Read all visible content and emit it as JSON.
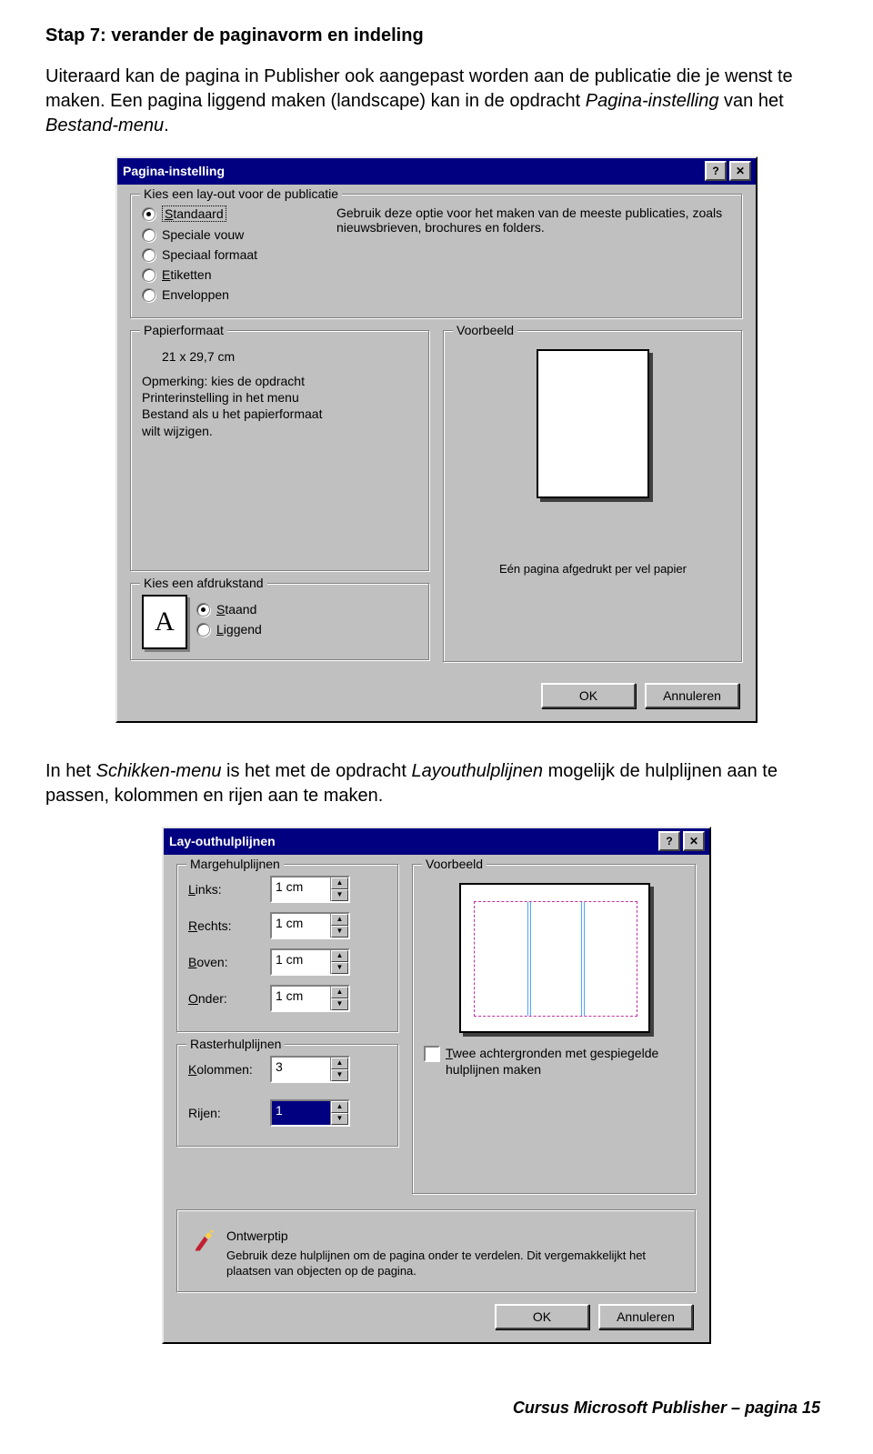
{
  "step_title": "Stap 7: verander de paginavorm en indeling",
  "intro": {
    "p1a": "Uiteraard kan de pagina in Publisher ook aangepast worden aan de publicatie die je wenst te maken. Een pagina liggend maken (landscape) kan in de opdracht ",
    "p1b": "Pagina-instelling",
    "p1c": " van het ",
    "p1d": "Bestand-menu",
    "p1e": "."
  },
  "dialog1": {
    "title": "Pagina-instelling",
    "layout_legend": "Kies een lay-out voor de publicatie",
    "options": {
      "standaard": "Standaard",
      "speciale_vouw": "Speciale vouw",
      "speciaal_formaat": "Speciaal formaat",
      "etiketten": "Etiketten",
      "enveloppen": "Enveloppen"
    },
    "desc": "Gebruik deze optie voor het maken van de meeste publicaties, zoals nieuwsbrieven, brochures en folders.",
    "papier_legend": "Papierformaat",
    "papier_size": "21 x 29,7 cm",
    "papier_note": "Opmerking: kies de opdracht Printerinstelling in het menu Bestand als u het papierformaat wilt wijzigen.",
    "voorbeeld_legend": "Voorbeeld",
    "voorbeeld_caption": "Eén pagina afgedrukt per vel papier",
    "orient_legend": "Kies een afdrukstand",
    "orient_a": "A",
    "orient_staand": "Staand",
    "orient_liggend": "Liggend",
    "ok": "OK",
    "cancel": "Annuleren"
  },
  "between": {
    "a": "In het ",
    "b": "Schikken-menu",
    "c": " is het met de opdracht ",
    "d": "Layouthulplijnen",
    "e": " mogelijk de hulplijnen aan te passen, kolommen en rijen aan te maken."
  },
  "dialog2": {
    "title": "Lay-outhulplijnen",
    "marge_legend": "Margehulplijnen",
    "links": "Links:",
    "rechts": "Rechts:",
    "boven": "Boven:",
    "onder": "Onder:",
    "val_1cm": "1 cm",
    "raster_legend": "Rasterhulplijnen",
    "kolommen": "Kolommen:",
    "kolommen_val": "3",
    "rijen": "Rijen:",
    "rijen_val": "1",
    "voorbeeld_legend": "Voorbeeld",
    "mirror_label": "Twee achtergronden met gespiegelde hulplijnen maken",
    "tip_title": "Ontwerptip",
    "tip_text": "Gebruik deze hulplijnen om de pagina onder te verdelen. Dit vergemakkelijkt het plaatsen van objecten op de pagina.",
    "ok": "OK",
    "cancel": "Annuleren"
  },
  "footer": "Cursus Microsoft Publisher – pagina 15"
}
